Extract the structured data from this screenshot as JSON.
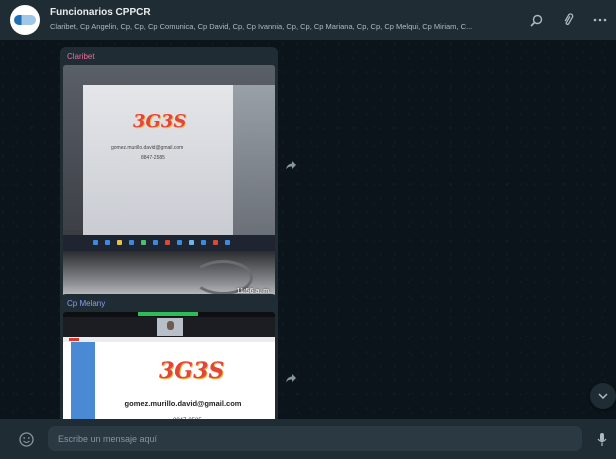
{
  "header": {
    "title": "Funcionarios CPPCR",
    "members": "Claribet, Cp Angelin, Cp, Cp, Cp Comunica, Cp David, Cp, Cp Ivannia, Cp, Cp, Cp Mariana, Cp, Cp, Cp Melqui, Cp Miriam, C...",
    "icons": [
      "search-icon",
      "paperclip-icon",
      "more-options-icon"
    ]
  },
  "messages": [
    {
      "sender": "Claribet",
      "sender_color": "#e2709a",
      "logo_text": "3G3S",
      "email": "gomez.murillo.david@gmail.com",
      "phone": "8847-2585",
      "time": "11:56 a. m."
    },
    {
      "sender": "Cp Melany",
      "sender_color": "#8b9cf0",
      "logo_text": "3G3S",
      "email": "gomez.murillo.david@gmail.com",
      "phone": "8847-2585"
    }
  ],
  "composer": {
    "placeholder": "Escribe un mensaje aquí"
  },
  "colors": {
    "header_bg": "#202c33",
    "chat_bg": "#0b141a",
    "bubble_bg": "#202c33",
    "input_bg": "#2a3942"
  }
}
